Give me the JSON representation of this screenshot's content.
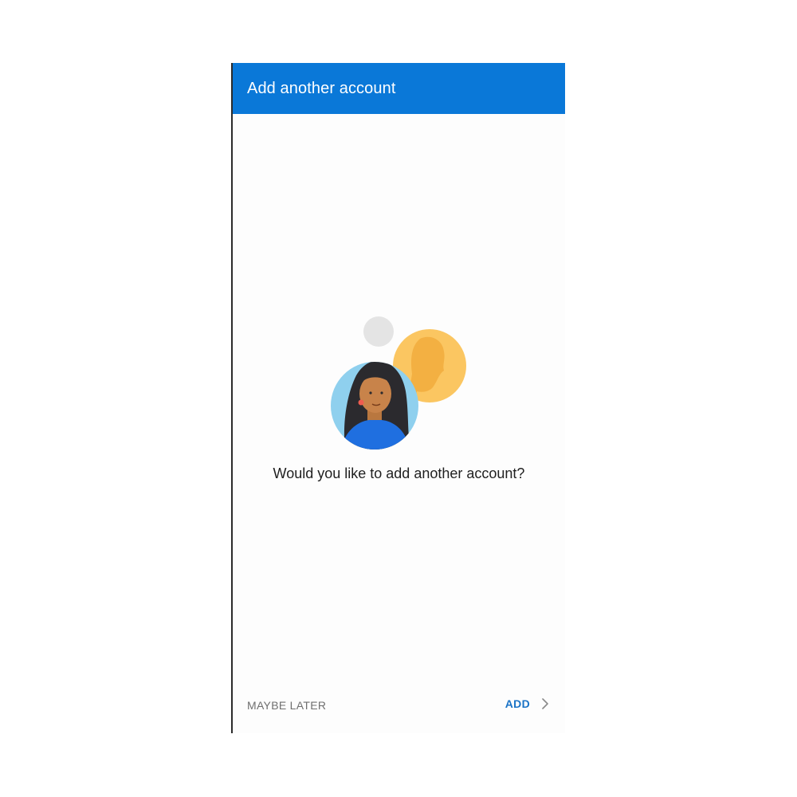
{
  "header": {
    "title": "Add another account"
  },
  "main": {
    "prompt": "Would you like to add another account?",
    "illustration_icon": "account-avatars-illustration"
  },
  "footer": {
    "secondary_label": "MAYBE LATER",
    "primary_label": "ADD",
    "primary_icon": "chevron-right-icon"
  },
  "colors": {
    "app_bar": "#0a78d8",
    "accent": "#1a73c6",
    "secondary_text": "#6f6f6f",
    "primary_text": "#1f1f1f"
  }
}
